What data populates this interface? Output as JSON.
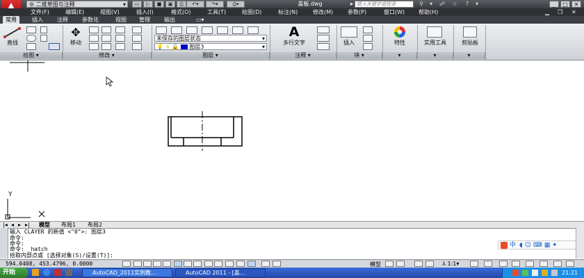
{
  "titlebar": {
    "workspace": "二维草图与注释",
    "document_title": "盖板.dwg",
    "search_placeholder": "键入关键字或短语"
  },
  "menus": [
    "文件(F)",
    "编辑(E)",
    "视图(V)",
    "插入(I)",
    "格式(O)",
    "工具(T)",
    "绘图(D)",
    "标注(N)",
    "修改(M)",
    "参数(P)",
    "窗口(W)",
    "帮助(H)"
  ],
  "tabs": [
    "常用",
    "插入",
    "注释",
    "参数化",
    "视图",
    "管理",
    "输出"
  ],
  "ribbon": {
    "draw": {
      "line": "直线",
      "footer": "绘图"
    },
    "modify": {
      "move": "移动",
      "footer": "修改"
    },
    "layers": {
      "state": "未保存的图层状态",
      "current": "图层3",
      "footer": "图层"
    },
    "annotation": {
      "mtext": "多行文字",
      "footer": "注释"
    },
    "block": {
      "insert": "插入",
      "footer": "块"
    },
    "properties": {
      "label": "特性"
    },
    "utilities": {
      "label": "实用工具"
    },
    "clipboard": {
      "label": "剪贴板"
    }
  },
  "axis": {
    "y": "Y",
    "x": "X"
  },
  "layout_tabs": {
    "model": "模型",
    "layout1": "布局1",
    "layout2": "布局2"
  },
  "command_lines": [
    "输入 CLAYER 的新值 <\"0\">: 图层3",
    "命令:",
    "命令:",
    "命令: _hatch",
    "拾取内部点或 [选择对象(S)/设置(T)]:"
  ],
  "status": {
    "coords": "594.0408, 453.4796, 0.0000",
    "model": "模型",
    "scale": "1:1"
  },
  "taskbar": {
    "start": "开始",
    "task1": "AutoCAD_2011实例教...",
    "task2": "AutoCAD 2011 - [盖...",
    "clock": "21:21"
  },
  "ime": {
    "label": "中"
  },
  "colors": {
    "layer_swatch": "#0000c8",
    "app_red": "#c01818"
  }
}
